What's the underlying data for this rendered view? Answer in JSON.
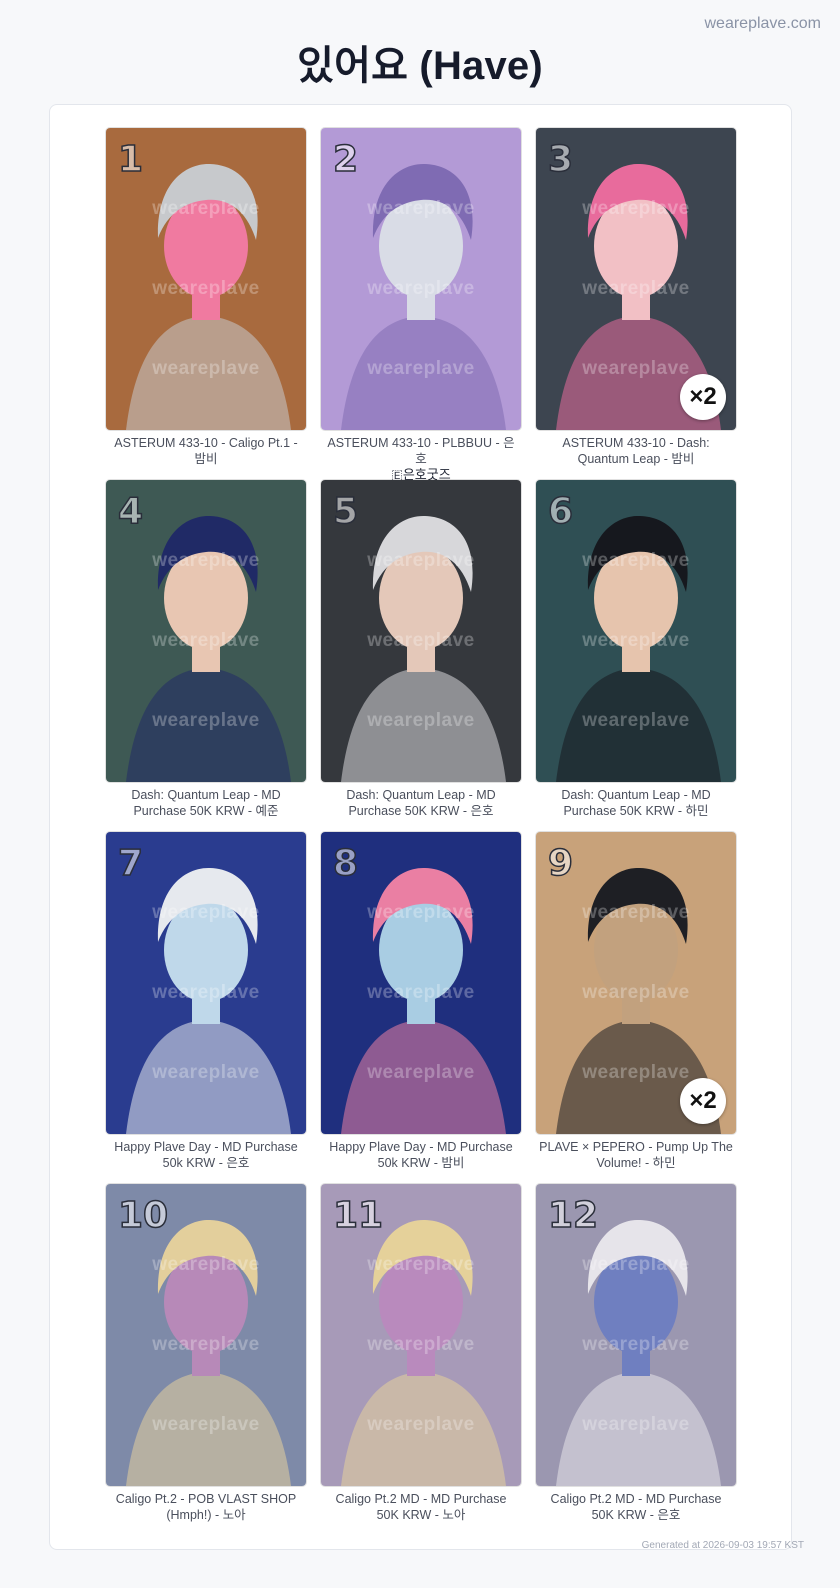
{
  "header": {
    "site_name": "weareplave.com",
    "title": "있어요 (Have)"
  },
  "watermark_text": "weareplave",
  "cards": [
    {
      "number": "1",
      "caption": "ASTERUM 433-10 - Caligo Pt.1 - 밤비",
      "extra": "",
      "count": "",
      "colors": [
        "#a86a3e",
        "#c7c9cc",
        "#f07aa0"
      ]
    },
    {
      "number": "2",
      "caption": "ASTERUM 433-10 - PLBBUU - 은호",
      "extra": "🇪은호굿즈",
      "count": "",
      "colors": [
        "#b39ad6",
        "#7f6bb3",
        "#d9dce6"
      ]
    },
    {
      "number": "3",
      "caption": "ASTERUM 433-10 - Dash: Quantum Leap - 밤비",
      "extra": "",
      "count": "×2",
      "colors": [
        "#3d4550",
        "#e86b9c",
        "#f2c0c5"
      ]
    },
    {
      "number": "4",
      "caption": "Dash: Quantum Leap - MD Purchase 50K KRW - 예준",
      "extra": "",
      "count": "",
      "colors": [
        "#3e5954",
        "#202a66",
        "#e8c6b2"
      ]
    },
    {
      "number": "5",
      "caption": "Dash: Quantum Leap - MD Purchase 50K KRW - 은호",
      "extra": "",
      "count": "",
      "colors": [
        "#35383d",
        "#d7d7da",
        "#e4c8b9"
      ]
    },
    {
      "number": "6",
      "caption": "Dash: Quantum Leap - MD Purchase 50K KRW - 하민",
      "extra": "",
      "count": "",
      "colors": [
        "#2f4f54",
        "#16181e",
        "#e6c4ad"
      ]
    },
    {
      "number": "7",
      "caption": "Happy Plave Day - MD Purchase 50k KRW - 은호",
      "extra": "",
      "count": "",
      "colors": [
        "#2a3c8f",
        "#e6e9ee",
        "#bfd8ea"
      ]
    },
    {
      "number": "8",
      "caption": "Happy Plave Day - MD Purchase 50k KRW - 밤비",
      "extra": "",
      "count": "",
      "colors": [
        "#1f2f7e",
        "#ea7fa3",
        "#a9cde3"
      ]
    },
    {
      "number": "9",
      "caption": "PLAVE × PEPERO - Pump Up The Volume! - 하민",
      "extra": "",
      "count": "×2",
      "colors": [
        "#c8a27a",
        "#1e1f24",
        "#c2a17e"
      ]
    },
    {
      "number": "10",
      "caption": "Caligo Pt.2 - POB VLAST SHOP (Hmph!) - 노아",
      "extra": "",
      "count": "",
      "colors": [
        "#7e8aa8",
        "#e3cf9c",
        "#b789b8"
      ]
    },
    {
      "number": "11",
      "caption": "Caligo Pt.2 MD - MD Purchase 50K KRW - 노아",
      "extra": "",
      "count": "",
      "colors": [
        "#a79ab8",
        "#e5d19a",
        "#b98abd"
      ]
    },
    {
      "number": "12",
      "caption": "Caligo Pt.2 MD - MD Purchase 50K KRW - 은호",
      "extra": "",
      "count": "",
      "colors": [
        "#9b97b0",
        "#e6e4ea",
        "#6f7fc0"
      ]
    }
  ],
  "footer": {
    "generated": "Generated at 2026-09-03 19:57 KST"
  }
}
